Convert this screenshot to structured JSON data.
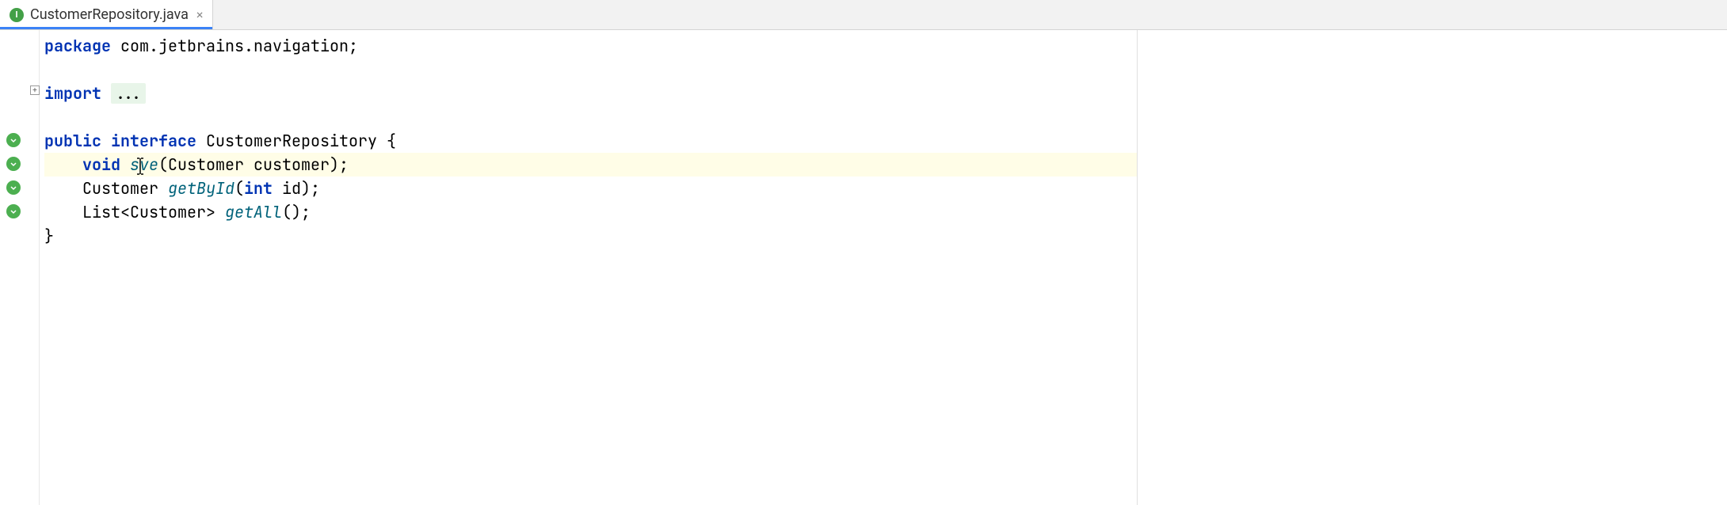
{
  "tab": {
    "icon_letter": "I",
    "label": "CustomerRepository.java",
    "close": "×"
  },
  "code": {
    "package_kw": "package",
    "package_name": " com.jetbrains.navigation",
    "import_kw": "import",
    "import_folded": "...",
    "public_kw": "public",
    "interface_kw": "interface",
    "interface_name": " CustomerRepository ",
    "brace_open": "{",
    "void_kw": "void",
    "save_method_pre": " s",
    "save_method_post": "ve",
    "save_params": "(Customer customer)",
    "customer_type": "Customer ",
    "getById_method": "getById",
    "getById_params_open": "(",
    "int_kw": "int",
    "getById_params_rest": " id)",
    "list_type": "List<Customer> ",
    "getAll_method": "getAll",
    "getAll_params": "()",
    "brace_close": "}",
    "semicolon": ";"
  },
  "gutter": {
    "fold_symbol": "+"
  }
}
